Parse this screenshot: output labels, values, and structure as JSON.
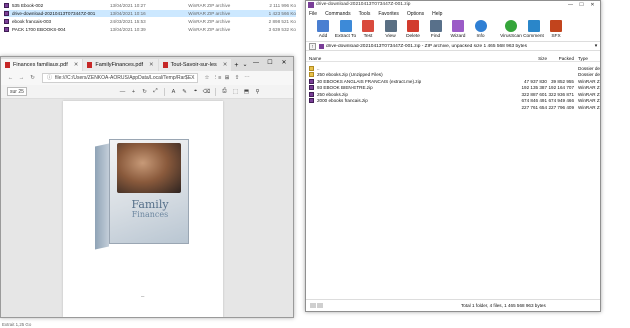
{
  "background_explorer": {
    "rows": [
      {
        "name": "535 Ebook-002",
        "date": "13/04/2021 10:27",
        "type": "WinRAR ZIP archive",
        "size": "2 111 996 Ko",
        "selected": false
      },
      {
        "name": "drive-download-20210413T073447Z-001",
        "date": "13/04/2021 10:16",
        "type": "WinRAR ZIP archive",
        "size": "1 423 566 Ko",
        "selected": true
      },
      {
        "name": "ebook francais-003",
        "date": "24/03/2021 15:53",
        "type": "WinRAR ZIP archive",
        "size": "2 898 521 Ko",
        "selected": false
      },
      {
        "name": "PACK 1700 EBOOKS-004",
        "date": "13/04/2021 10:39",
        "type": "WinRAR ZIP archive",
        "size": "3 639 532 Ko",
        "selected": false
      }
    ]
  },
  "edge": {
    "tabs": [
      {
        "label": "Finances familiaux.pdf",
        "active": true
      },
      {
        "label": "FamilyFinances.pdf",
        "active": false
      },
      {
        "label": "Tout-Savoir-sur-les",
        "active": false
      }
    ],
    "new_tab": "+",
    "tab_menu": "⌄",
    "window_buttons": {
      "minimize": "—",
      "maximize": "☐",
      "close": "✕"
    },
    "nav": {
      "back": "←",
      "forward": "→",
      "refresh": "↻"
    },
    "url": "file:///C:/Users/ZENKOA-AORUS/AppData/Local/Temp/Rar$EX",
    "lock_glyph": "ⓘ",
    "toolbar_icons": {
      "fav": "☆",
      "reading": "⋮≡",
      "collections": "⊞",
      "share": "⇪",
      "more": "⋯"
    },
    "page_label": "sur 25",
    "pdf_tools": {
      "zoom_out": "—",
      "zoom_in": "+",
      "rotate": "↻",
      "fit": "⤢",
      "read_aloud": "A",
      "highlight": "✎",
      "draw": "⌖",
      "erase": "⌫",
      "print": "⎙",
      "save": "⬚",
      "save_as": "⬒",
      "pin": "⚲"
    },
    "book": {
      "title_main": "Family",
      "title_sub": "Finances"
    },
    "page_dash": "–"
  },
  "winrar": {
    "title": "drive-download-20210413T073447Z-001.zip",
    "window_buttons": {
      "minimize": "—",
      "maximize": "☐",
      "close": "✕"
    },
    "menu": [
      "File",
      "Commands",
      "Tools",
      "Favorites",
      "Options",
      "Help"
    ],
    "toolbar": [
      {
        "label": "Add",
        "icon": "add-icon",
        "color": "#4a7fd1"
      },
      {
        "label": "Extract To",
        "icon": "extract-icon",
        "color": "#3d8ad8"
      },
      {
        "label": "Test",
        "icon": "test-icon",
        "color": "#d94a3d"
      },
      {
        "label": "View",
        "icon": "view-icon",
        "color": "#5a6f83"
      },
      {
        "label": "Delete",
        "icon": "delete-icon",
        "color": "#d23c2e"
      },
      {
        "label": "Find",
        "icon": "find-icon",
        "color": "#58708a"
      },
      {
        "label": "Wizard",
        "icon": "wizard-icon",
        "color": "#9b5bc7"
      },
      {
        "label": "Info",
        "icon": "info-icon",
        "color": "#2f7fd4"
      },
      {
        "label": "VirusScan",
        "icon": "virusscan-icon",
        "color": "#35a53a"
      },
      {
        "label": "Comment",
        "icon": "comment-icon",
        "color": "#2a86c9"
      },
      {
        "label": "SFX",
        "icon": "sfx-icon",
        "color": "#c2441d"
      }
    ],
    "path_up": "↑",
    "path": "drive-download-20210413T073447Z-001.zip - ZIP archive, unpacked size 1 465 568 963 bytes",
    "path_dropdown": "▾",
    "columns": {
      "name": "Name",
      "size": "Size",
      "packed": "Packed",
      "type": "Type"
    },
    "files": [
      {
        "name": "..",
        "size": "",
        "packed": "",
        "type": "Dossier de f",
        "icon": "folder"
      },
      {
        "name": "250 ebooks.zip (Unzipped Files)",
        "size": "",
        "packed": "",
        "type": "Dossier de f",
        "icon": "folder"
      },
      {
        "name": "30 EBOOKS ANGLAIS FRANCAIS (extract.me).zip",
        "size": "47 937 830",
        "packed": "39 852 955",
        "type": "WinRAR ZIP",
        "icon": "rar"
      },
      {
        "name": "93 EBOOK BIEN-ETRE.zip",
        "size": "192 135 387",
        "packed": "192 164 707",
        "type": "WinRAR ZIP",
        "icon": "rar"
      },
      {
        "name": "250 ebooks.zip",
        "size": "322 887 601",
        "packed": "322 936 871",
        "type": "WinRAR ZIP",
        "icon": "rar"
      },
      {
        "name": "2000 ebooks francais.zip",
        "size": "674 846 491",
        "packed": "674 949 466",
        "type": "WinRAR ZIP",
        "icon": "rar"
      },
      {
        "name": "",
        "size": "227 761 654",
        "packed": "227 796 409",
        "type": "WinRAR ZIP",
        "icon": "none"
      }
    ],
    "status": "Total 1 folder, 4 files, 1 465 568 963 bytes"
  },
  "bottom_text": "Extrait 1,25 Go"
}
